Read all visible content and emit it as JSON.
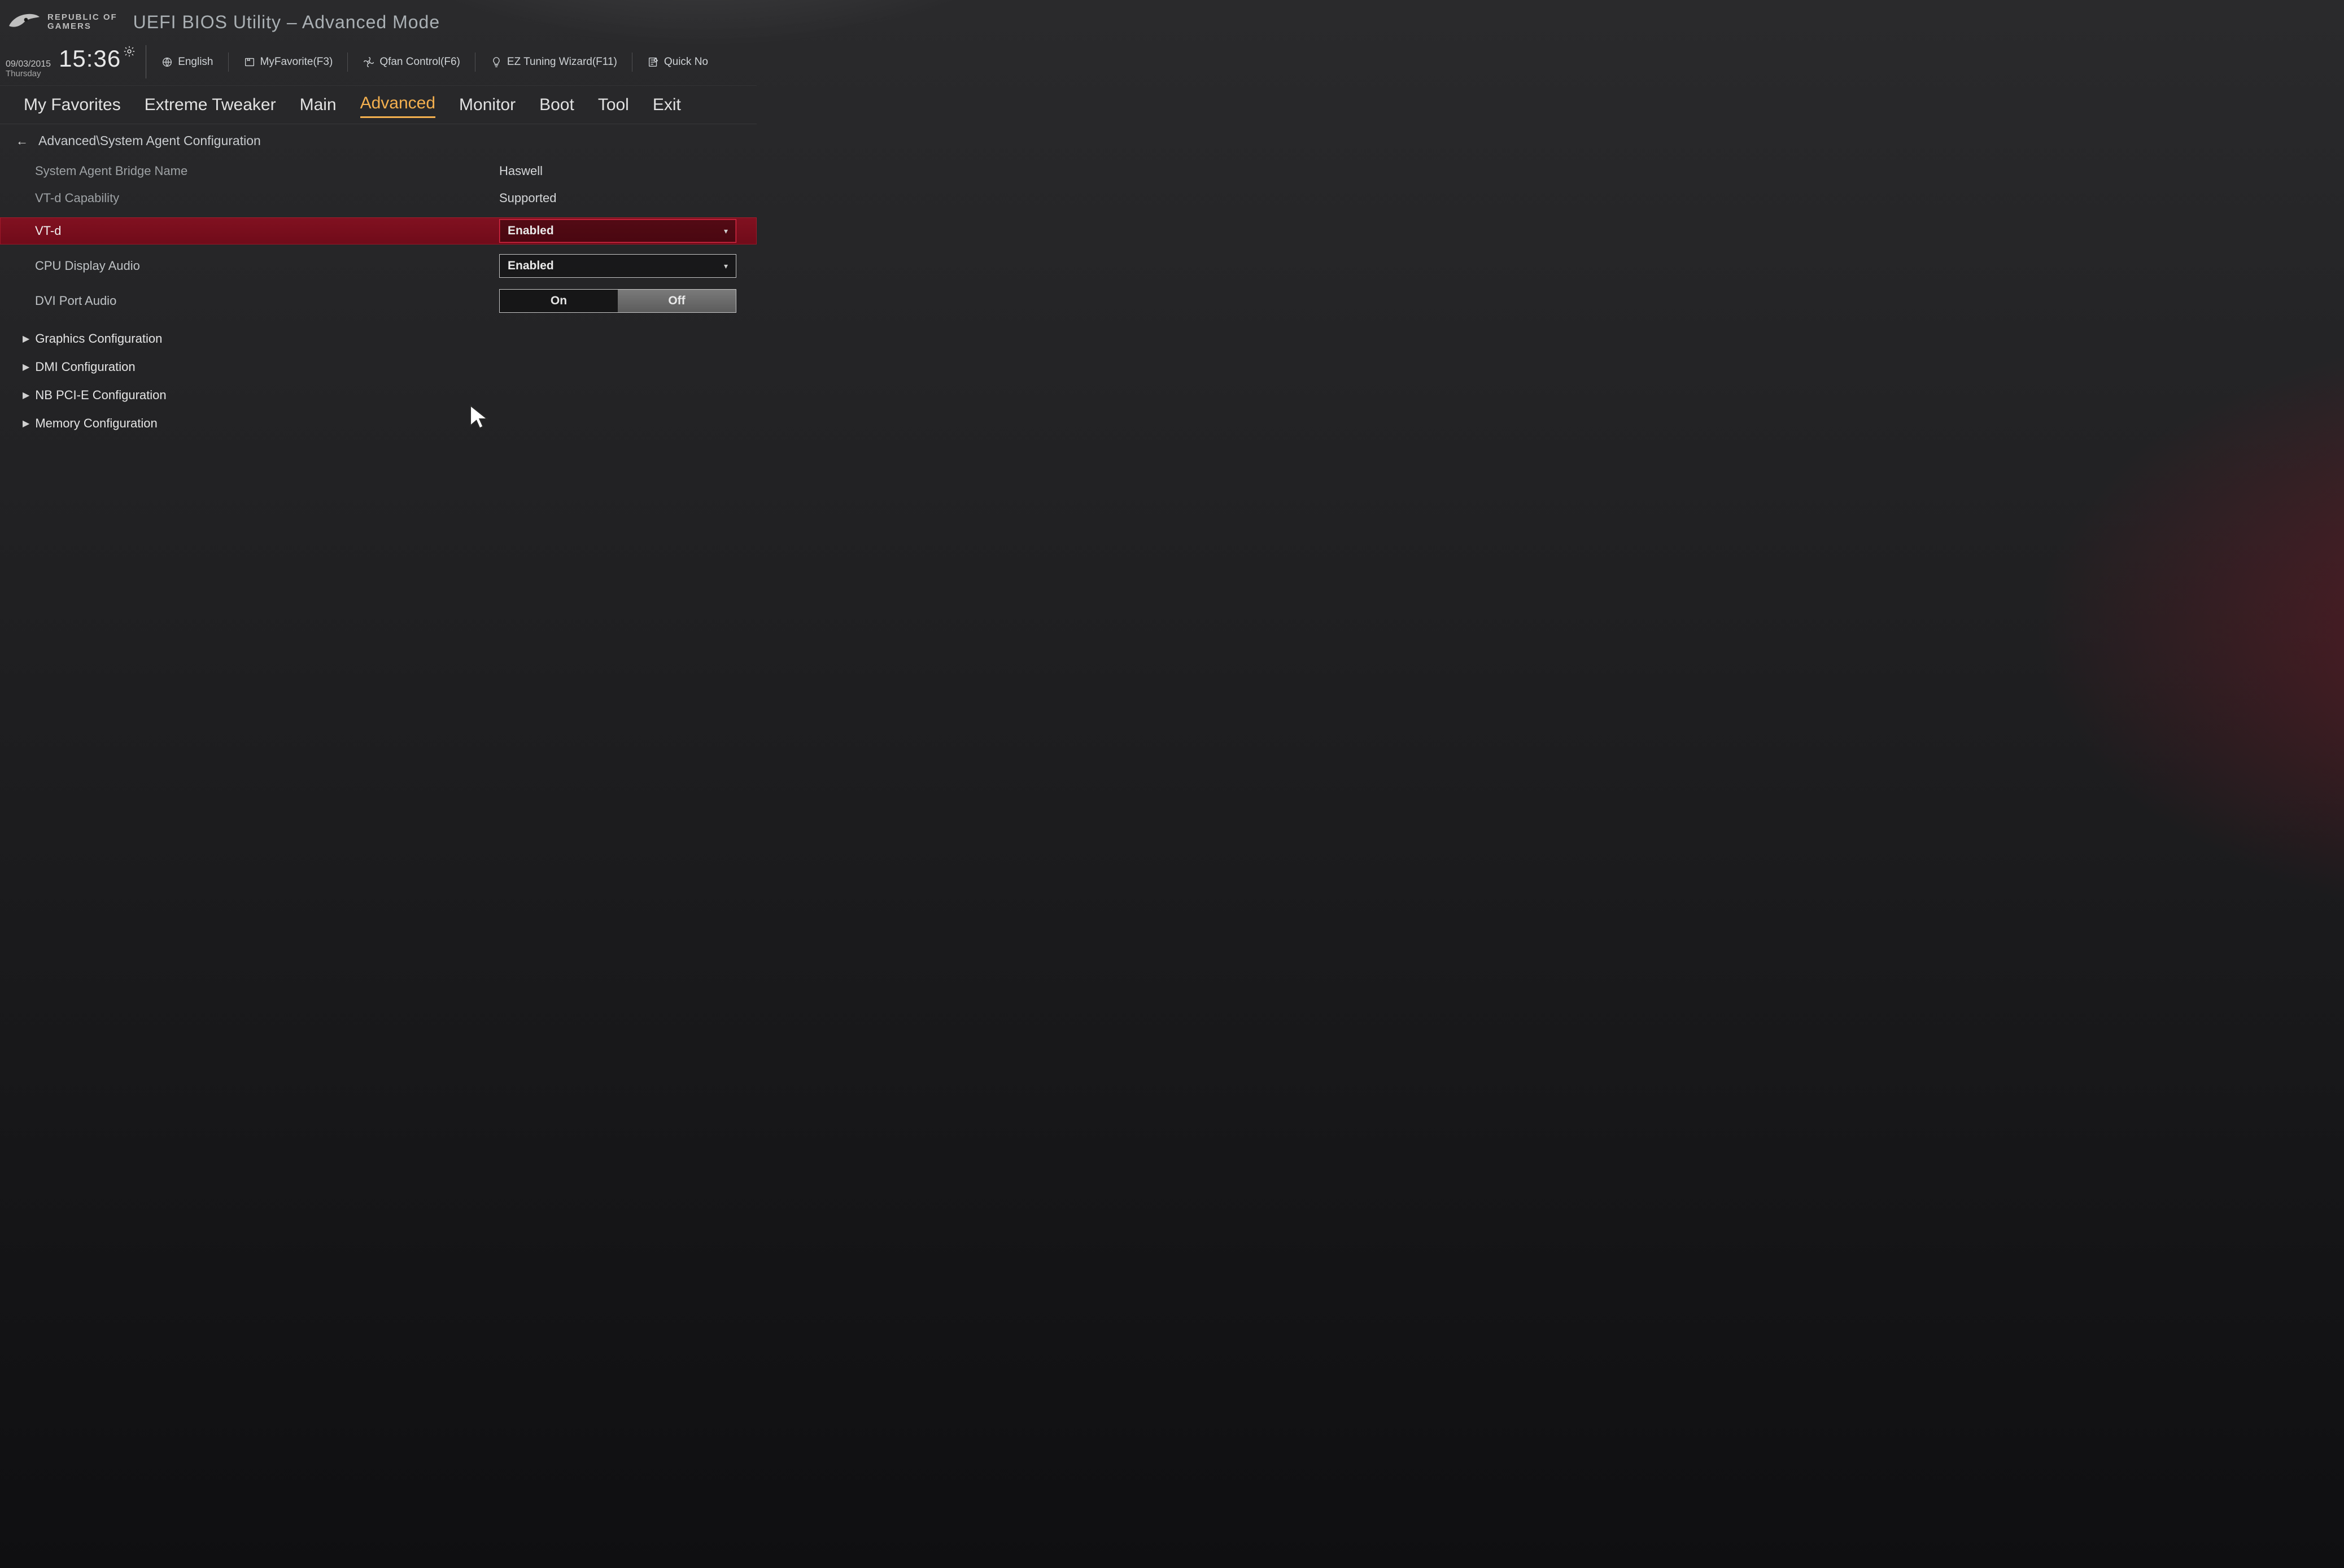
{
  "brand": {
    "line1": "REPUBLIC OF",
    "line2": "GAMERS"
  },
  "app_title": "UEFI BIOS Utility – Advanced Mode",
  "datetime": {
    "date": "09/03/2015",
    "day": "Thursday",
    "time": "15:36"
  },
  "shortcuts": {
    "language": "English",
    "favorite": "MyFavorite(F3)",
    "qfan": "Qfan Control(F6)",
    "wizard": "EZ Tuning Wizard(F11)",
    "quicknote": "Quick No"
  },
  "tabs": [
    "My Favorites",
    "Extreme Tweaker",
    "Main",
    "Advanced",
    "Monitor",
    "Boot",
    "Tool",
    "Exit"
  ],
  "active_tab_index": 3,
  "breadcrumb": "Advanced\\System Agent Configuration",
  "rows": {
    "bridge_label": "System Agent Bridge Name",
    "bridge_value": "Haswell",
    "vtd_cap_label": "VT-d Capability",
    "vtd_cap_value": "Supported",
    "vtd_label": "VT-d",
    "vtd_value": "Enabled",
    "cpu_audio_label": "CPU Display Audio",
    "cpu_audio_value": "Enabled",
    "dvi_label": "DVI Port Audio",
    "dvi_on": "On",
    "dvi_off": "Off"
  },
  "subs": {
    "graphics": "Graphics Configuration",
    "dmi": "DMI Configuration",
    "nbpcie": "NB PCI-E Configuration",
    "memory": "Memory Configuration"
  }
}
